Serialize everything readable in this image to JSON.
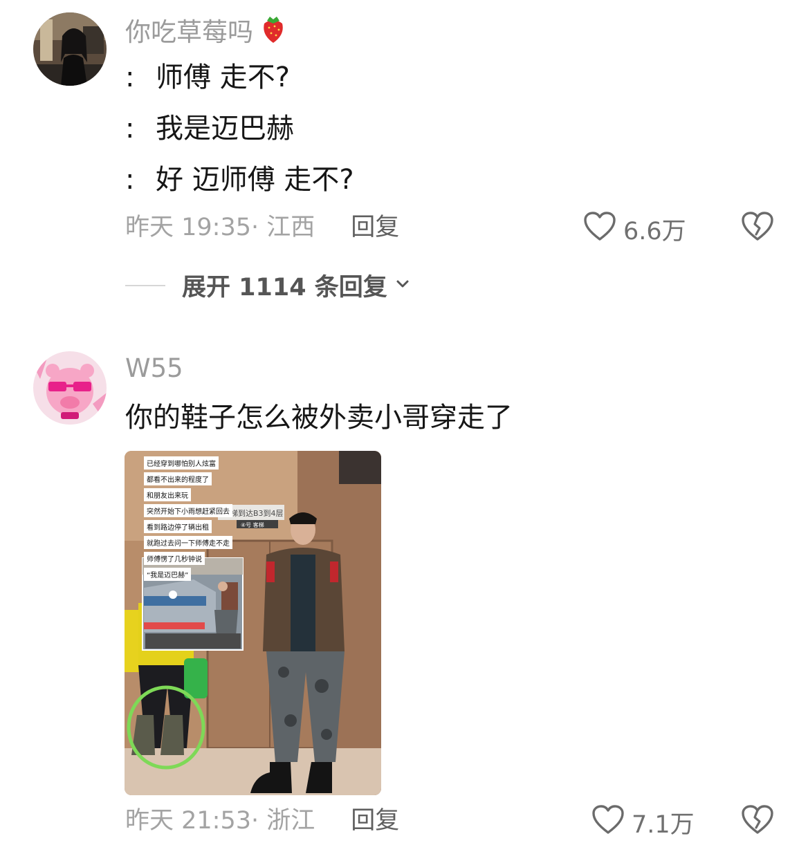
{
  "comments": [
    {
      "username": "你吃草莓吗",
      "username_emoji": "strawberry-icon",
      "lines": [
        "师傅 走不?",
        "我是迈巴赫",
        "好 迈师傅 走不?"
      ],
      "line_prefix": ":",
      "time_location": "昨天 19:35· 江西",
      "reply_label": "回复",
      "likes": "6.6万",
      "expand_label": "展开 1114 条回复"
    },
    {
      "username": "W55",
      "text": "你的鞋子怎么被外卖小哥穿走了",
      "time_location": "昨天 21:53· 浙江",
      "reply_label": "回复",
      "likes": "7.1万",
      "image": {
        "captions": [
          "已经穿到哪怕别人炫富",
          "都看不出来的程度了",
          "和朋友出来玩",
          "突然开始下小雨想赶紧回去",
          "看到路边停了辆出租",
          "就跑过去问一下师傅走不走",
          "师傅愣了几秒钟说",
          "“我是迈巴赫”"
        ],
        "sign_text": "本梯到达B3到4层",
        "sign_sub": "④号 客梯"
      }
    }
  ],
  "colors": {
    "username": "#9b9b9b",
    "meta": "#a3a3a3",
    "reply": "#5f5f5f",
    "highlight_circle": "#7ed957"
  }
}
